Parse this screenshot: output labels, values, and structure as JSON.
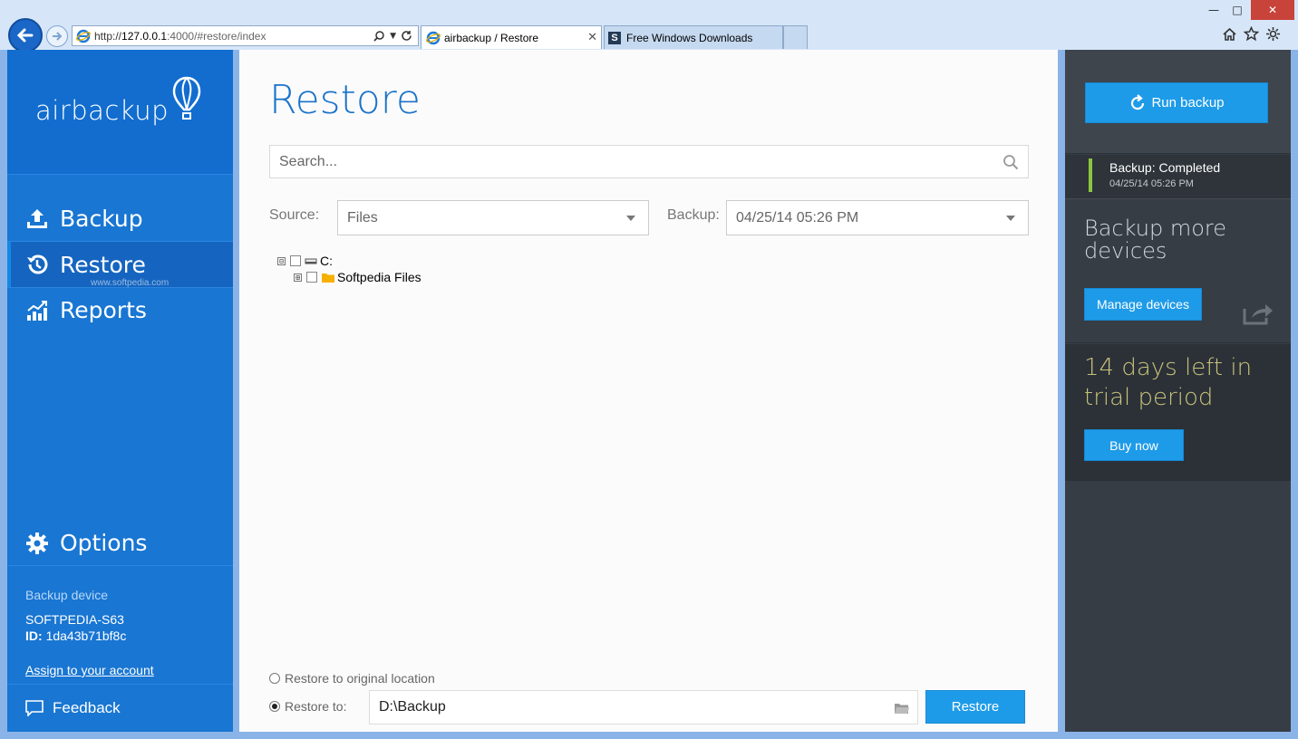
{
  "browser": {
    "url_prefix": "http://",
    "url_host": "127.0.0.1",
    "url_path": ":4000/#restore/index",
    "tabs": [
      {
        "label": "airbackup / Restore",
        "active": true
      },
      {
        "label": "Free Windows Downloads",
        "active": false
      }
    ],
    "window": {
      "minimize": "—",
      "maximize": "□",
      "close": "✕"
    }
  },
  "sidebar": {
    "logo": "airbackup",
    "items": [
      {
        "label": "Backup",
        "icon": "upload-icon"
      },
      {
        "label": "Restore",
        "icon": "history-icon",
        "active": true
      },
      {
        "label": "Reports",
        "icon": "chart-icon"
      },
      {
        "label": "Options",
        "icon": "gear-icon"
      }
    ],
    "watermark": "www.softpedia.com",
    "device_label": "Backup device",
    "device_name": "SOFTPEDIA-S63",
    "device_id_label": "ID:",
    "device_id": "1da43b71bf8c",
    "assign_link": "Assign to your account",
    "feedback": "Feedback"
  },
  "main": {
    "title": "Restore",
    "search_placeholder": "Search...",
    "source_label": "Source:",
    "source_value": "Files",
    "backup_label": "Backup:",
    "backup_value": "04/25/14 05:26 PM",
    "tree": {
      "root": {
        "label": "C:",
        "expander": "⊟"
      },
      "child": {
        "label": "Softpedia Files",
        "expander": "⊞"
      }
    },
    "restore_original": "Restore to original location",
    "restore_to": "Restore to:",
    "destination": "D:\\Backup",
    "restore_button": "Restore"
  },
  "right_panel": {
    "run_backup": "Run backup",
    "status_title": "Backup: Completed",
    "status_time": "04/25/14 05:26 PM",
    "more_title": "Backup more devices",
    "manage_devices": "Manage devices",
    "trial_text": "14 days left in trial period",
    "buy_now": "Buy now"
  },
  "colors": {
    "sidebar_blue": "#1976d2",
    "accent_button": "#1e9be8",
    "title_blue": "#1a73c9",
    "status_green": "#8cc63f",
    "trial_text": "#c9c27a",
    "panel_dark": "#363d45"
  }
}
